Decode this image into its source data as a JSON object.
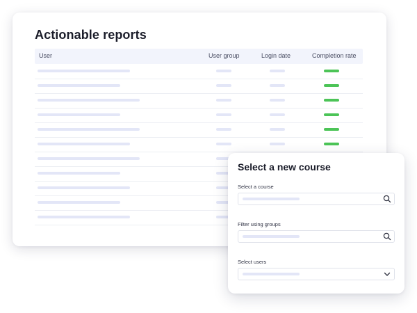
{
  "report": {
    "title": "Actionable reports",
    "columns": {
      "user": "User",
      "user_group": "User group",
      "login_date": "Login date",
      "completion_rate": "Completion rate"
    },
    "rows_with_completion_bar": 6,
    "colors": {
      "placeholder_bar": "#e3e6f7",
      "completion_bar": "#4cc457",
      "header_background": "#f2f4fc"
    }
  },
  "course_dialog": {
    "title": "Select a new course",
    "fields": [
      {
        "label": "Select a course",
        "icon": "search-icon"
      },
      {
        "label": "Filter using groups",
        "icon": "search-icon"
      },
      {
        "label": "Select users",
        "icon": "chevron-down-icon"
      }
    ]
  }
}
